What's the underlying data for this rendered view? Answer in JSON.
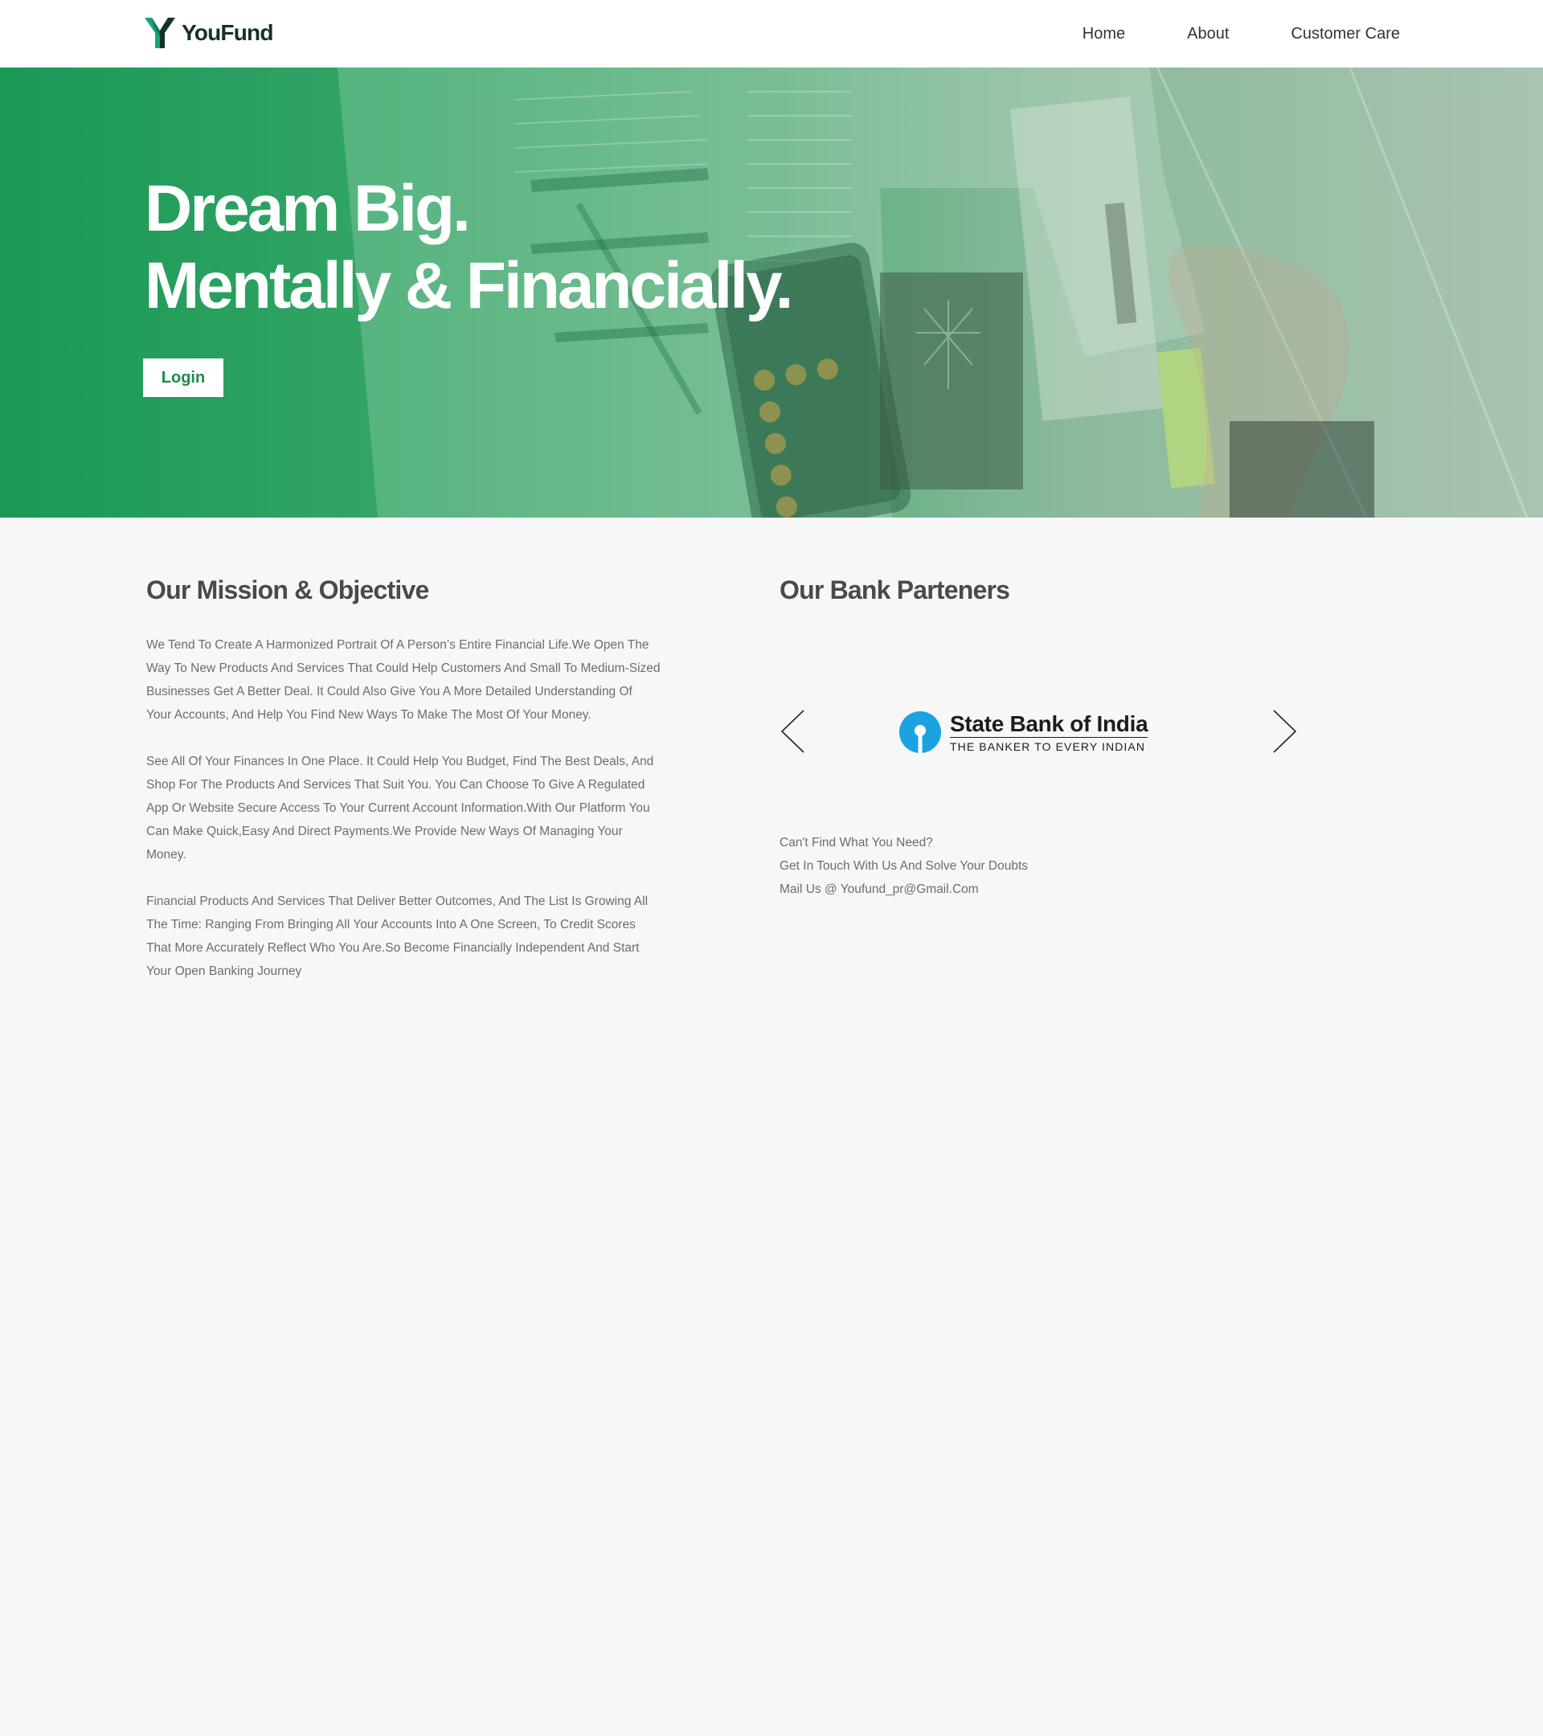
{
  "navbar": {
    "brand": "YouFund",
    "links": [
      "Home",
      "About",
      "Customer Care"
    ]
  },
  "hero": {
    "title_line1": "Dream Big.",
    "title_line2": "Mentally & Financially.",
    "login_label": "Login"
  },
  "mission": {
    "title": "Our Mission & Objective",
    "paragraphs": [
      "We Tend To Create A Harmonized Portrait Of A Person’s Entire Financial Life.We Open The Way To New Products And Services That Could Help Customers And Small To Medium-Sized Businesses Get A Better Deal. It Could Also Give You A More Detailed Understanding Of Your Accounts, And Help You Find New Ways To Make The Most Of Your Money.",
      "See All Of Your Finances In One Place. It Could Help You Budget, Find The Best Deals, And Shop For The Products And Services That Suit You. You Can Choose To Give A Regulated App Or Website Secure Access To Your Current Account Information.With Our Platform You Can Make Quick,Easy And Direct Payments.We Provide New Ways Of Managing Your Money.",
      "Financial Products And Services That Deliver Better Outcomes, And The List Is Growing All The Time: Ranging From Bringing All Your Accounts Into A One Screen, To Credit Scores That More Accurately Reflect Who You Are.So Become Financially Independent And Start Your Open Banking Journey"
    ]
  },
  "partners": {
    "title": "Our Bank Parteners",
    "bank_name": "State Bank of India",
    "bank_tagline": "THE BANKER TO EVERY INDIAN",
    "contact_lines": [
      "Can't Find What You Need?",
      "Get In Touch With Us And Solve Your Doubts",
      "Mail Us @ Youfund_pr@Gmail.Com"
    ]
  },
  "colors": {
    "brand_green": "#1a9856",
    "sbi_blue": "#1aa3e0",
    "text_gray": "#6d6d6d",
    "heading_gray": "#4a4a4a"
  },
  "icons": {
    "brand": "youfund-y-logo-icon",
    "carousel_prev": "chevron-left-icon",
    "carousel_next": "chevron-right-icon",
    "bank": "sbi-keyhole-logo-icon"
  }
}
